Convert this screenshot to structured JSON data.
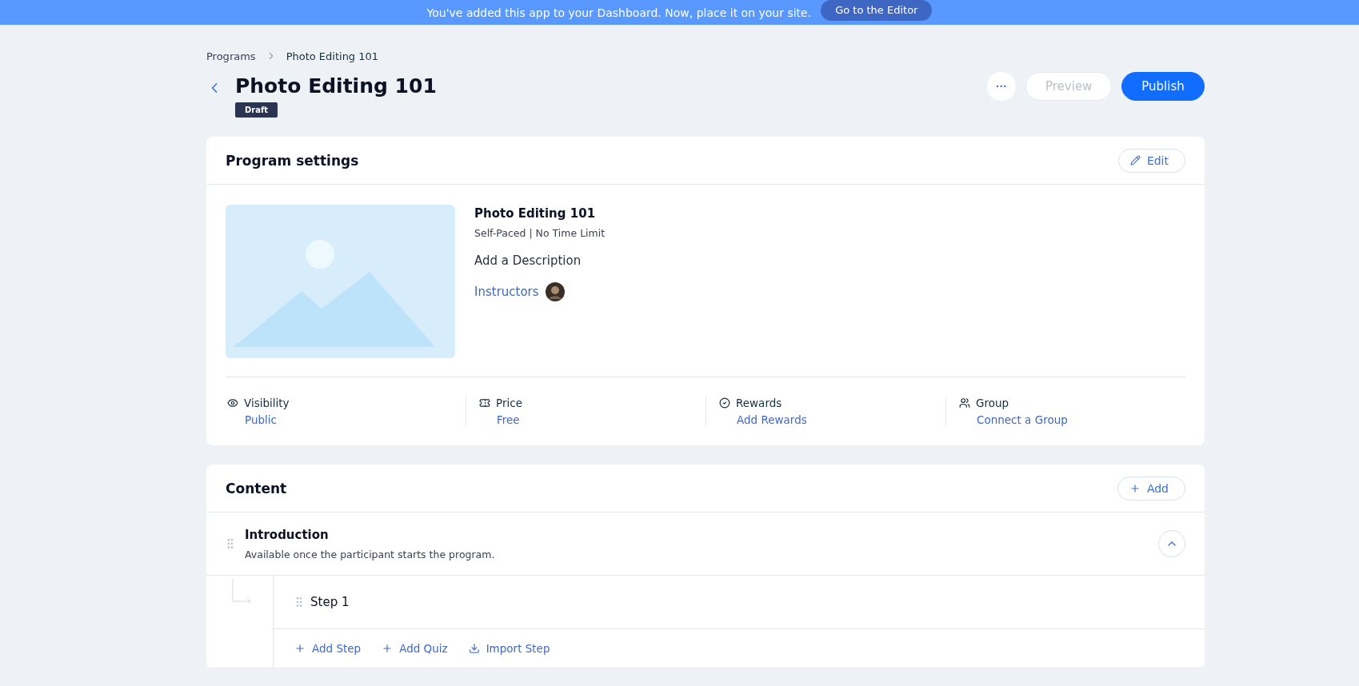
{
  "banner": {
    "text": "You've added this app to your Dashboard. Now, place it on your site.",
    "button": "Go to the Editor"
  },
  "breadcrumbs": [
    {
      "label": "Programs"
    },
    {
      "label": "Photo Editing 101"
    }
  ],
  "header": {
    "title": "Photo Editing 101",
    "status": "Draft",
    "more": "···",
    "buttons": [
      {
        "label": "Preview",
        "disabled": true,
        "primary": false
      },
      {
        "label": "Publish",
        "disabled": false,
        "primary": true
      }
    ]
  },
  "program_settings": {
    "title": "Program settings",
    "edit": "Edit",
    "name": "Photo Editing 101",
    "schedule": "Self-Paced | No Time Limit",
    "description": "Add a Description",
    "instructors": "Instructors",
    "stats": [
      {
        "label": "Visibility",
        "value": "Public"
      },
      {
        "label": "Price",
        "value": "Free"
      },
      {
        "label": "Rewards",
        "value": "Add Rewards"
      },
      {
        "label": "Group",
        "value": "Connect a Group"
      }
    ]
  },
  "content": {
    "title": "Content",
    "add": "Add",
    "sections": [
      {
        "title": "Introduction",
        "subtitle": "Available once the participant starts the program.",
        "expanded": true,
        "steps": [
          {
            "title": "Step 1"
          }
        ],
        "actions": [
          {
            "label": "Add Step"
          },
          {
            "label": "Add Quiz"
          },
          {
            "label": "Import Step"
          }
        ]
      }
    ]
  }
}
